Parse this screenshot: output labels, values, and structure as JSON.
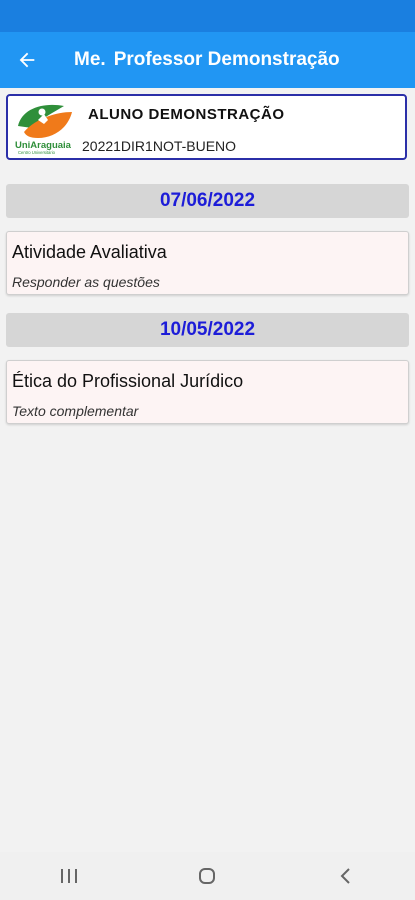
{
  "app_bar": {
    "title_prefix": "Me.",
    "title": "Professor Demonstração",
    "back_icon": "arrow-left-icon"
  },
  "student": {
    "name": "ALUNO DEMONSTRAÇÃO",
    "code": "20221DIR1NOT-BUENO",
    "logo": {
      "name": "UniAraguaia",
      "tagline": "Centro Universitário",
      "colors": {
        "green": "#2f8f3a",
        "orange": "#f07a1a"
      }
    }
  },
  "sections": [
    {
      "date": "07/06/2022",
      "activities": [
        {
          "title": "Atividade Avaliativa",
          "description": "Responder as questões"
        }
      ]
    },
    {
      "date": "10/05/2022",
      "activities": [
        {
          "title": "Ética do Profissional Jurídico",
          "description": "Texto complementar"
        }
      ]
    }
  ],
  "nav": {
    "recent_icon": "recent-apps-icon",
    "home_icon": "home-icon",
    "back_icon": "back-chevron-icon"
  },
  "colors": {
    "primary": "#2196f3",
    "status_bar": "#1a7fe0",
    "date_text": "#1d1dd8",
    "card_border": "#2b2fa8",
    "activity_bg": "#fdf4f4"
  }
}
